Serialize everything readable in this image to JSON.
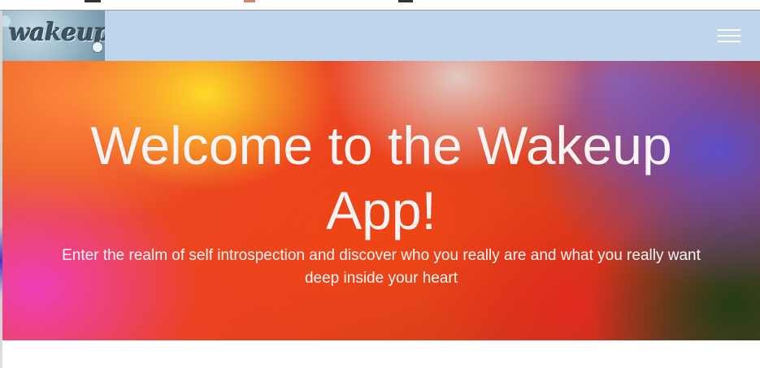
{
  "navbar": {
    "logo_text": "wakeup",
    "background_color": "#bfd5ec",
    "menu_icon": "hamburger-menu-icon"
  },
  "hero": {
    "title_line1": "Welcome to the Wakeup",
    "title_line2": "App!",
    "subtitle_line1": "Enter the realm of self introspection and discover who you really are and what you really want",
    "subtitle_line2": "deep inside your heart"
  }
}
